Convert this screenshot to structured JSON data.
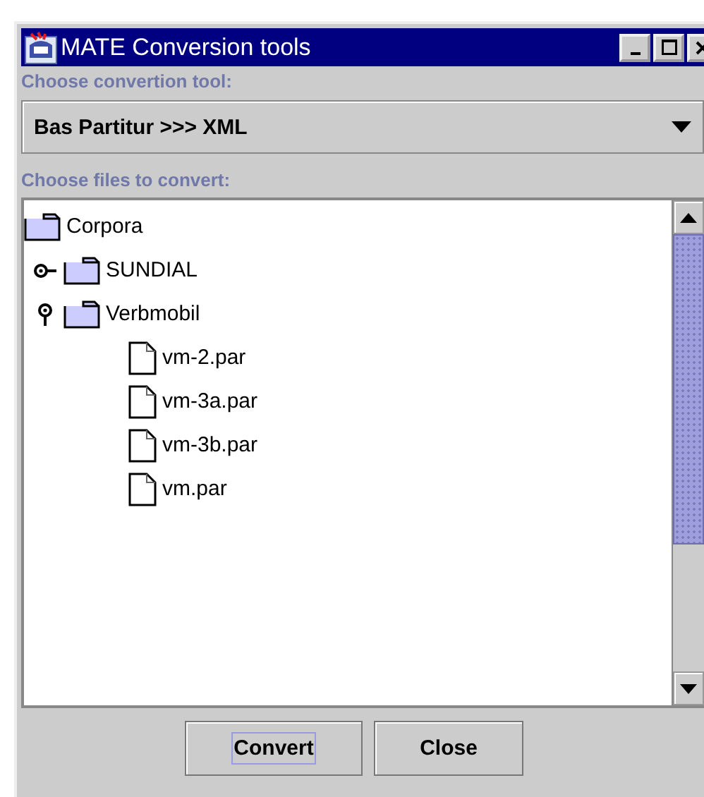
{
  "window": {
    "title": "MATE Conversion tools"
  },
  "tool_label": "Choose convertion tool:",
  "tool_select": {
    "value": "Bas Partitur >>> XML"
  },
  "files_label": "Choose files to convert:",
  "tree": [
    {
      "label": "Corpora",
      "kind": "folder",
      "children": [
        {
          "label": "SUNDIAL",
          "kind": "folder",
          "expanded": false
        },
        {
          "label": "Verbmobil",
          "kind": "folder",
          "expanded": true,
          "children": [
            {
              "label": "vm-2.par",
              "kind": "file"
            },
            {
              "label": "vm-3a.par",
              "kind": "file"
            },
            {
              "label": "vm-3b.par",
              "kind": "file"
            },
            {
              "label": "vm.par",
              "kind": "file"
            }
          ]
        }
      ]
    }
  ],
  "buttons": [
    {
      "label": "Convert",
      "focused": true
    },
    {
      "label": "Close",
      "focused": false
    }
  ]
}
